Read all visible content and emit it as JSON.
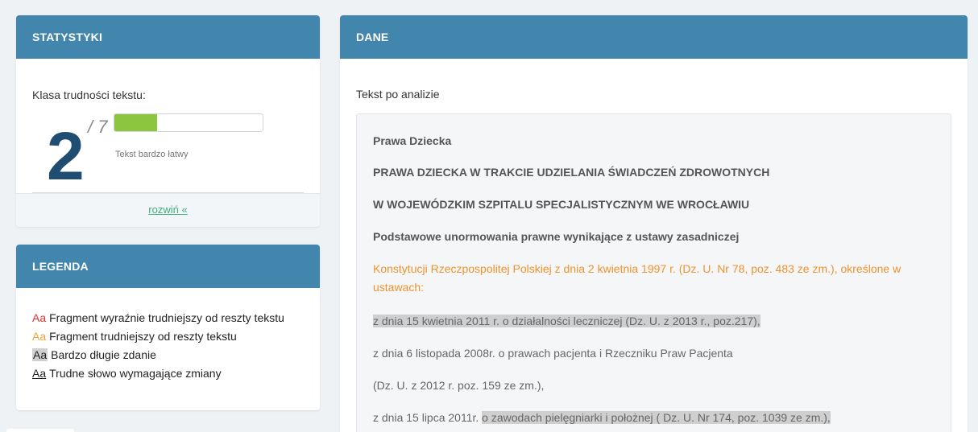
{
  "stats": {
    "title": "STATYSTYKI",
    "label": "Klasa trudności tekstu:",
    "score": "2",
    "denominator": "/ 7",
    "progress_fraction": 0.286,
    "progress_color": "#8cc63f",
    "description": "Tekst bardzo łatwy",
    "expand_link": "rozwiń «"
  },
  "legend": {
    "title": "LEGENDA",
    "items": [
      {
        "sample": "Aa",
        "label": "Fragment wyraźnie trudniejszy od reszty tekstu"
      },
      {
        "sample": "Aa",
        "label": "Fragment trudniejszy od reszty tekstu"
      },
      {
        "sample": "Aa",
        "label": "Bardzo długie zdanie"
      },
      {
        "sample": "Aa",
        "label": "Trudne słowo wymagające zmiany"
      }
    ]
  },
  "dane": {
    "title": "DANE",
    "label": "Tekst po analizie",
    "lines": [
      "Prawa Dziecka",
      "PRAWA DZIECKA W TRAKCIE UDZIELANIA ŚWIADCZEŃ ZDROWOTNYCH",
      "W WOJEWÓDZKIM SZPITALU SPECJALISTYCZNYM WE WROCŁAWIU",
      "Podstawowe unormowania prawne wynikające z ustawy zasadniczej",
      "Konstytucji Rzeczpospolitej Polskiej z dnia 2 kwietnia 1997 r. (Dz. U. Nr 78, poz. 483 ze zm.), określone w ustawach:",
      "z dnia 15 kwietnia 2011 r. o działalności leczniczej (Dz. U. z 2013 r., poz.217),",
      "z dnia 6 listopada 2008r. o prawach pacjenta i Rzeczniku Praw Pacjenta",
      "(Dz. U. z 2012 r. poz. 159 ze zm.),",
      "z dnia 15 lipca 2011r.",
      "o zawodach pielęgniarki i położnej ( Dz. U. Nr 174, poz. 1039 ze zm.),"
    ]
  },
  "colors": {
    "header": "#4386ad",
    "score": "#1f4e72",
    "link": "#3dae7d",
    "difficult_red": "#e0302b",
    "difficult_orange": "#f5a030"
  }
}
